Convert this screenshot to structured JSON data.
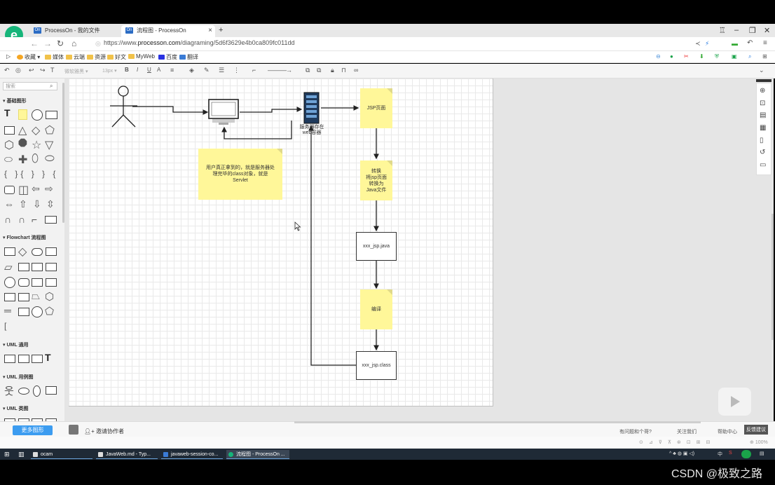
{
  "browser": {
    "tabs": [
      {
        "icon": "On",
        "label": "ProcessOn - 我的文件"
      },
      {
        "icon": "On",
        "label": "流程图 - ProcessOn"
      }
    ],
    "new_tab": "+",
    "url_prefix": "https://www.",
    "url_domain": "processon.com",
    "url_path": "/diagraming/5d6f3629e4b0ca809fc011dd"
  },
  "bookmarks": [
    "收藏",
    "媒体",
    "云端",
    "资源",
    "好文",
    "MyWeb",
    "百度",
    "翻译"
  ],
  "toolbar": {
    "font_family": "微软雅黑",
    "font_size": "13px",
    "bold": "B",
    "italic": "I",
    "underline": "U",
    "font_color": "A"
  },
  "left_panel": {
    "search_placeholder": "搜索",
    "sections": [
      "基础图形",
      "Flowchart 流程图",
      "UML 通用",
      "UML 用例图",
      "UML 类图"
    ],
    "more_shapes": "更多图形"
  },
  "diagram": {
    "server_label": "服务器存在\nweb容器",
    "jsp_page": "JSP页面",
    "convert_note": "转换\n将jsp页面\n转换为\nJava文件",
    "java_file": "xxx_jsp.java",
    "compile_note": "编译",
    "class_file": "xxx_jsp.class",
    "user_note": "用户真正拿到的，就是服务器处理完毕的class对象，就是Servlet"
  },
  "bottom": {
    "invite": "邀请协作者",
    "right_items": [
      "有问题和个哥?",
      "关注我们",
      "帮助中心",
      "反馈建议"
    ],
    "zoom": "100%"
  },
  "taskbar": {
    "items": [
      "ocam",
      "JavaWeb.md - Typ...",
      "javaweb-session-co...",
      "流程图 - ProcessOn ..."
    ],
    "tray_lang": "中"
  },
  "watermark": "CSDN @极致之路",
  "colors": {
    "sticky": "#fff799",
    "accent": "#3c9cf0",
    "brand": "#16b57a"
  }
}
